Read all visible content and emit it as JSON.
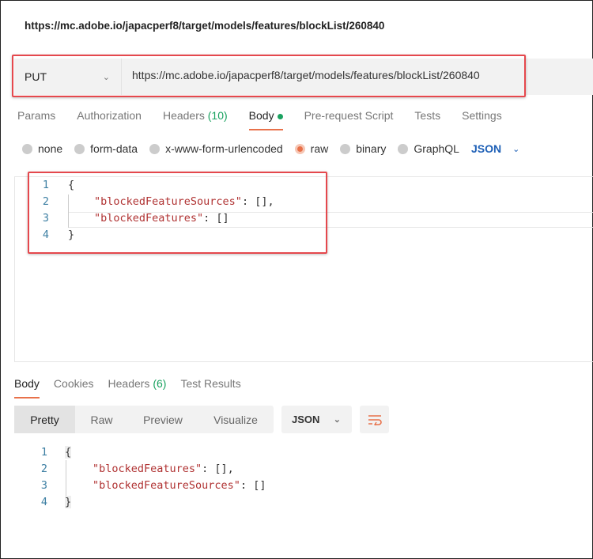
{
  "title": "https://mc.adobe.io/japacperf8/target/models/features/blockList/260840",
  "request": {
    "method": "PUT",
    "url": "https://mc.adobe.io/japacperf8/target/models/features/blockList/260840"
  },
  "tabs": [
    {
      "label": "Params"
    },
    {
      "label": "Authorization"
    },
    {
      "label": "Headers",
      "count": "(10)"
    },
    {
      "label": "Body"
    },
    {
      "label": "Pre-request Script"
    },
    {
      "label": "Tests"
    },
    {
      "label": "Settings"
    }
  ],
  "body_types": [
    {
      "label": "none"
    },
    {
      "label": "form-data"
    },
    {
      "label": "x-www-form-urlencoded"
    },
    {
      "label": "raw",
      "selected": true
    },
    {
      "label": "binary"
    },
    {
      "label": "GraphQL"
    }
  ],
  "body_format": "JSON",
  "request_body": {
    "lines": [
      "1",
      "2",
      "3",
      "4"
    ],
    "open": "{",
    "k1": "\"blockedFeatureSources\"",
    "v1": ": [],",
    "k2": "\"blockedFeatures\"",
    "v2": ": []",
    "close": "}"
  },
  "response_tabs": [
    {
      "label": "Body"
    },
    {
      "label": "Cookies"
    },
    {
      "label": "Headers",
      "count": "(6)"
    },
    {
      "label": "Test Results"
    }
  ],
  "view_modes": [
    "Pretty",
    "Raw",
    "Preview",
    "Visualize"
  ],
  "response_format": "JSON",
  "response_body": {
    "lines": [
      "1",
      "2",
      "3",
      "4"
    ],
    "open": "{",
    "k1": "\"blockedFeatures\"",
    "v1": ": [],",
    "k2": "\"blockedFeatureSources\"",
    "v2": ": []",
    "close": "}"
  },
  "colors": {
    "accent": "#e8714a",
    "highlight_box": "#e5484d",
    "string": "#b03232",
    "link": "#1d5fb6",
    "green": "#1aa260"
  }
}
